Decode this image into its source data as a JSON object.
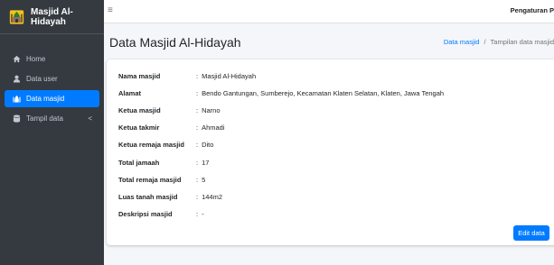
{
  "sidebar": {
    "brand": "Masjid Al-Hidayah",
    "items": [
      {
        "label": "Home",
        "icon": "home-icon"
      },
      {
        "label": "Data user",
        "icon": "user-icon"
      },
      {
        "label": "Data masjid",
        "icon": "mosque-icon",
        "active": true
      },
      {
        "label": "Tampil data",
        "icon": "database-icon",
        "chevron": "<"
      }
    ]
  },
  "topbar": {
    "menu_icon": "hamburger-icon",
    "right_text": "Pengaturan P"
  },
  "page": {
    "title": "Data Masjid Al-Hidayah",
    "breadcrumb": {
      "link": "Data masjid",
      "separator": "/",
      "current": "Tampilan data masjid"
    }
  },
  "details": [
    {
      "label": "Nama masjid",
      "value": "Masjid Al-Hidayah"
    },
    {
      "label": "Alamat",
      "value": "Bendo Gantungan, Sumberejo, Kecamatan Klaten Selatan, Klaten, Jawa Tengah"
    },
    {
      "label": "Ketua masjid",
      "value": "Narno"
    },
    {
      "label": "Ketua takmir",
      "value": "Ahmadi"
    },
    {
      "label": "Ketua remaja masjid",
      "value": "Dito"
    },
    {
      "label": "Total jamaah",
      "value": "17"
    },
    {
      "label": "Total remaja masjid",
      "value": "5"
    },
    {
      "label": "Luas tanah masjid",
      "value": "144m2"
    },
    {
      "label": "Deskripsi masjid",
      "value": "-"
    }
  ],
  "actions": {
    "edit_label": "Edit data"
  },
  "colors": {
    "sidebar": "#343a40",
    "accent": "#007bff",
    "background": "#f4f6f9"
  }
}
